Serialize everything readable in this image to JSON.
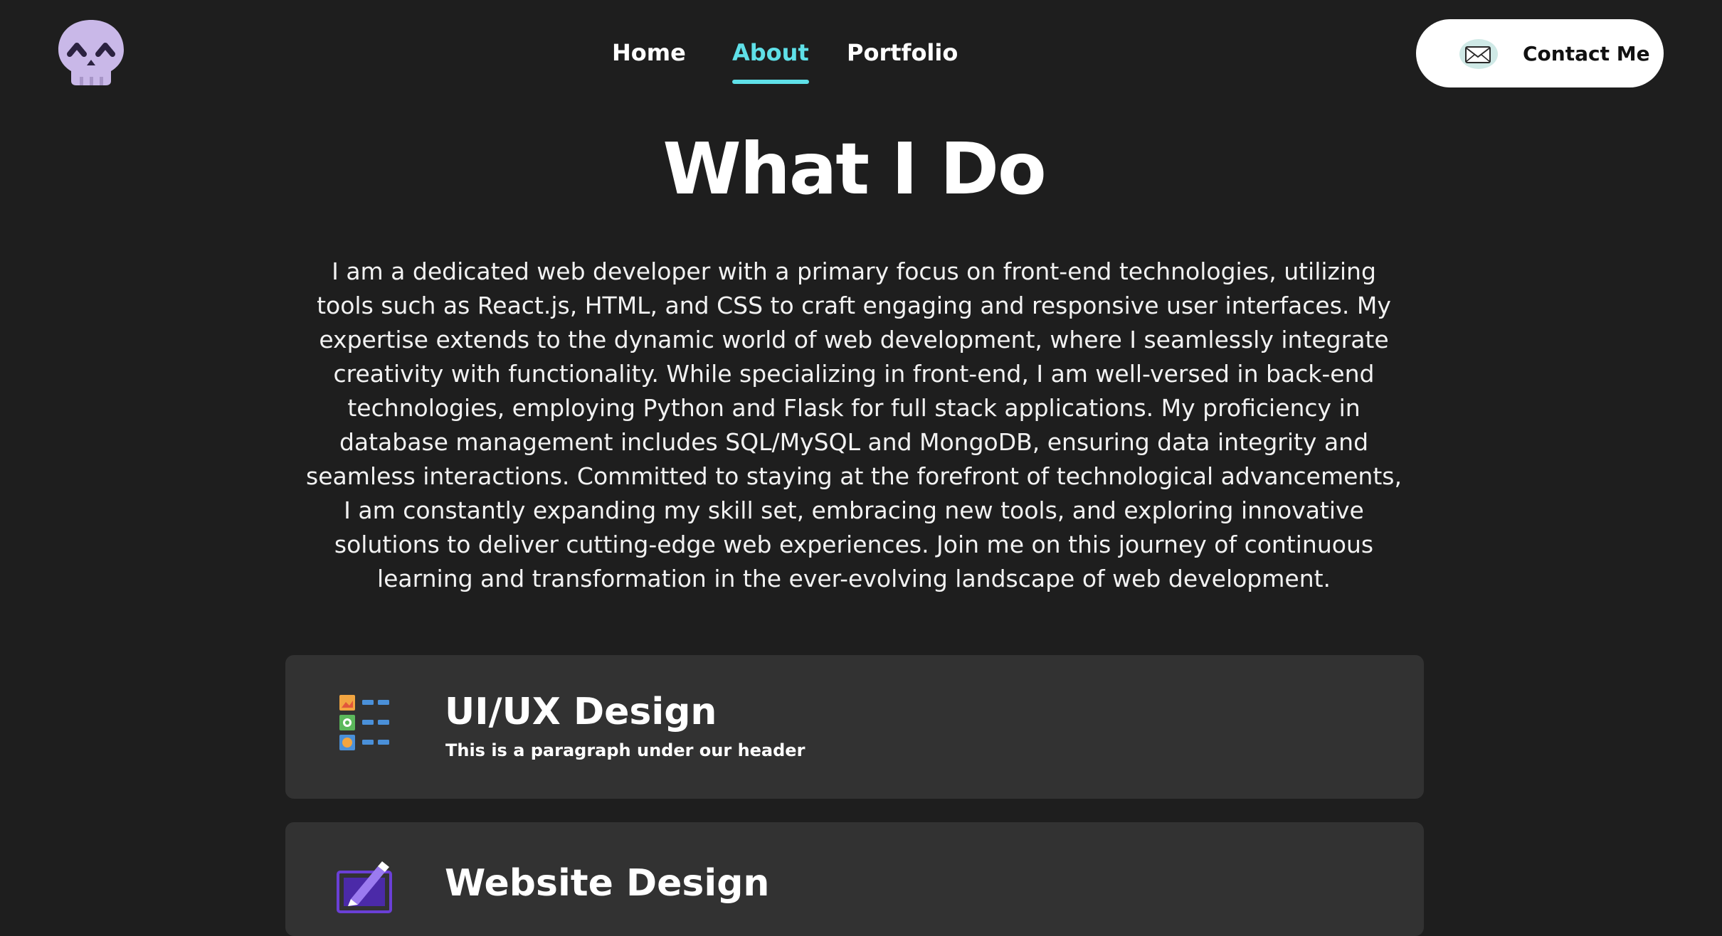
{
  "header": {
    "logo_icon": "skull-icon",
    "nav": [
      {
        "label": "Home",
        "active": false
      },
      {
        "label": "About",
        "active": true
      },
      {
        "label": "Portfolio",
        "active": false
      }
    ],
    "contact": {
      "label": "Contact Me",
      "icon": "envelope-icon"
    }
  },
  "main": {
    "title": "What I Do",
    "intro": "I am a dedicated web developer with a primary focus on front-end technologies, utilizing tools such as React.js, HTML, and CSS to craft engaging and responsive user interfaces. My expertise extends to the dynamic world of web development, where I seamlessly integrate creativity with functionality. While specializing in front-end, I am well-versed in back-end technologies, employing Python and Flask for full stack applications. My proficiency in database management includes SQL/MySQL and MongoDB, ensuring data integrity and seamless interactions. Committed to staying at the forefront of technological advancements, I am constantly expanding my skill set, embracing new tools, and exploring innovative solutions to deliver cutting-edge web experiences. Join me on this journey of continuous learning and transformation in the ever-evolving landscape of web development.",
    "services": [
      {
        "title": "UI/UX Design",
        "description": "This is a paragraph under our header",
        "icon": "ui-layout-icon"
      },
      {
        "title": "Website Design",
        "icon": "drawing-tablet-icon"
      }
    ]
  },
  "colors": {
    "background": "#1e1e1e",
    "card": "#323232",
    "accent": "#5fe0e8",
    "logo": "#c9b8e8"
  }
}
